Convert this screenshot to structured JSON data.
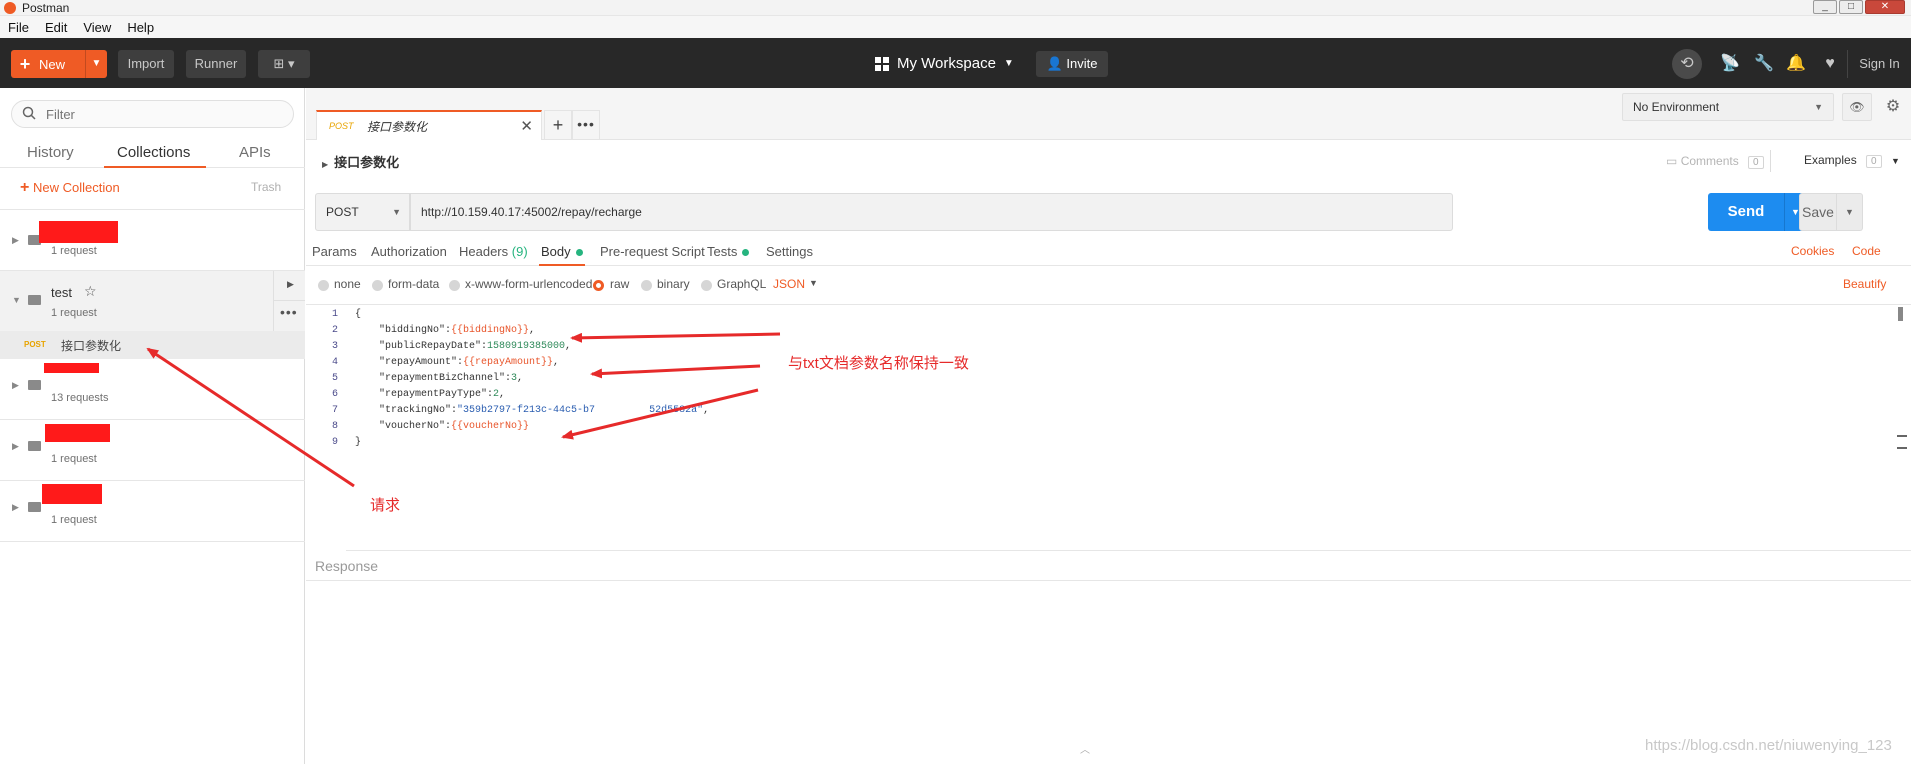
{
  "window": {
    "title": "Postman",
    "min": "_",
    "max": "□",
    "close": "✕"
  },
  "menu": [
    "File",
    "Edit",
    "View",
    "Help"
  ],
  "toolbar": {
    "new_label": "New",
    "import_label": "Import",
    "runner_label": "Runner",
    "workspace_label": "My Workspace",
    "invite_label": "Invite",
    "signin_label": "Sign In"
  },
  "sidebar": {
    "filter_placeholder": "Filter",
    "tabs": [
      "History",
      "Collections",
      "APIs"
    ],
    "new_collection": "New Collection",
    "trash": "Trash",
    "collections": [
      {
        "name": "",
        "count": "1 request"
      },
      {
        "name": "test",
        "count": "1 request"
      },
      {
        "name": "",
        "count": "13 requests"
      },
      {
        "name": "",
        "count": "1 request"
      },
      {
        "name": "",
        "count": "1 request"
      }
    ],
    "request": {
      "method": "POST",
      "name": "接口参数化"
    }
  },
  "tab": {
    "method": "POST",
    "name": "接口参数化"
  },
  "environment": {
    "selected": "No Environment"
  },
  "request": {
    "breadcrumb": "接口参数化",
    "comments_label": "Comments",
    "comments_count": "0",
    "examples_label": "Examples",
    "examples_count": "0",
    "method": "POST",
    "url": "http://10.159.40.17:45002/repay/recharge",
    "send_label": "Send",
    "save_label": "Save"
  },
  "request_tabs": {
    "params": "Params",
    "authorization": "Authorization",
    "headers": "Headers",
    "headers_count": "(9)",
    "body": "Body",
    "prerequest": "Pre-request Script",
    "tests": "Tests",
    "settings": "Settings",
    "cookies": "Cookies",
    "code": "Code"
  },
  "body_options": {
    "none": "none",
    "form_data": "form-data",
    "urlencoded": "x-www-form-urlencoded",
    "raw": "raw",
    "binary": "binary",
    "graphql": "GraphQL",
    "format": "JSON",
    "beautify": "Beautify"
  },
  "editor": {
    "line_numbers": [
      "1",
      "2",
      "3",
      "4",
      "5",
      "6",
      "7",
      "8",
      "9"
    ],
    "lines": [
      [
        {
          "t": "{",
          "c": "k"
        }
      ],
      [
        {
          "t": "    \"biddingNo\":",
          "c": "k"
        },
        {
          "t": "{{biddingNo}}",
          "c": "v-var"
        },
        {
          "t": ",",
          "c": "k"
        }
      ],
      [
        {
          "t": "    \"publicRepayDate\":",
          "c": "k"
        },
        {
          "t": "1580919385000",
          "c": "v-num"
        },
        {
          "t": ",",
          "c": "k"
        }
      ],
      [
        {
          "t": "    \"repayAmount\":",
          "c": "k"
        },
        {
          "t": "{{repayAmount}}",
          "c": "v-var"
        },
        {
          "t": ",",
          "c": "k"
        }
      ],
      [
        {
          "t": "    \"repaymentBizChannel\":",
          "c": "k"
        },
        {
          "t": "3",
          "c": "v-num"
        },
        {
          "t": ",",
          "c": "k"
        }
      ],
      [
        {
          "t": "    \"repaymentPayType\":",
          "c": "k"
        },
        {
          "t": "2",
          "c": "v-num"
        },
        {
          "t": ",",
          "c": "k"
        }
      ],
      [
        {
          "t": "    \"trackingNo\":",
          "c": "k"
        },
        {
          "t": "\"359b2797-f213c-44c5-b7",
          "c": "v-str"
        },
        {
          "t": "         ",
          "c": "k"
        },
        {
          "t": "52d5582a\"",
          "c": "v-str"
        },
        {
          "t": ",",
          "c": "k"
        }
      ],
      [
        {
          "t": "    \"voucherNo\":",
          "c": "k"
        },
        {
          "t": "{{voucherNo}}",
          "c": "v-var"
        }
      ],
      [
        {
          "t": "}",
          "c": "k"
        }
      ]
    ]
  },
  "response": {
    "label": "Response"
  },
  "annotations": {
    "param_note": "与txt文档参数名称保持一致",
    "request_note": "请求"
  },
  "watermark": "https://blog.csdn.net/niuwenying_123",
  "colors": {
    "accent": "#ef5b25",
    "send": "#1d8cf0",
    "annotation": "#e62a2a"
  }
}
